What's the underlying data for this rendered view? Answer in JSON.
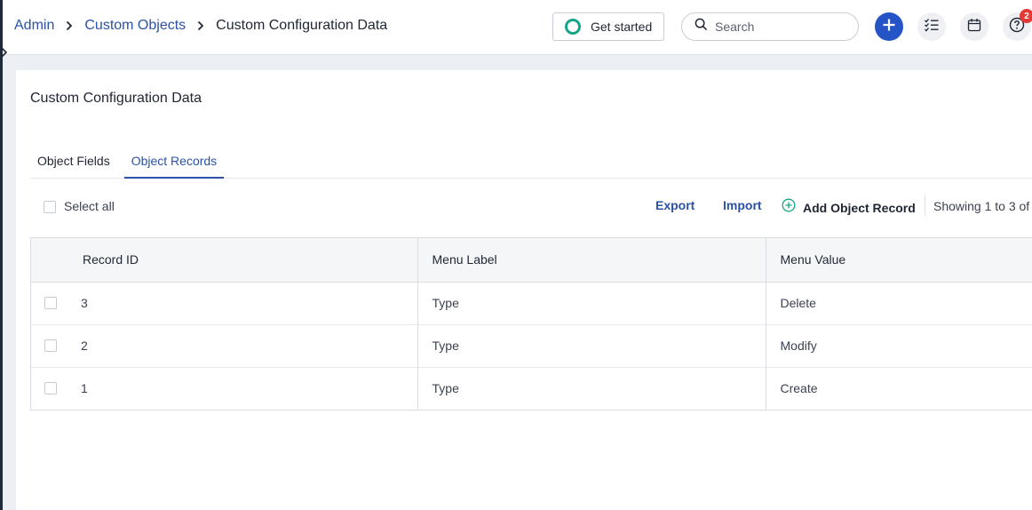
{
  "breadcrumb": {
    "items": [
      {
        "label": "Admin"
      },
      {
        "label": "Custom Objects"
      }
    ],
    "current": "Custom Configuration Data"
  },
  "header": {
    "get_started_label": "Get started",
    "search_placeholder": "Search",
    "notification_count": "2",
    "colors": {
      "accent": "#2554c7",
      "link": "#2b52a6",
      "success": "#17a589",
      "badge": "#e53935"
    },
    "icons": [
      "plus-icon",
      "task-list-icon",
      "calendar-icon",
      "help-icon"
    ]
  },
  "page": {
    "title": "Custom Configuration Data"
  },
  "tabs": [
    {
      "label": "Object Fields",
      "active": false
    },
    {
      "label": "Object Records",
      "active": true
    }
  ],
  "toolbar": {
    "select_all_label": "Select all",
    "export_label": "Export",
    "import_label": "Import",
    "add_record_label": "Add Object Record",
    "pager_text": "Showing 1 to 3 of"
  },
  "table": {
    "columns": [
      "Record ID",
      "Menu Label",
      "Menu Value"
    ],
    "rows": [
      {
        "record_id": "3",
        "menu_label": "Type",
        "menu_value": "Delete"
      },
      {
        "record_id": "2",
        "menu_label": "Type",
        "menu_value": "Modify"
      },
      {
        "record_id": "1",
        "menu_label": "Type",
        "menu_value": "Create"
      }
    ]
  }
}
